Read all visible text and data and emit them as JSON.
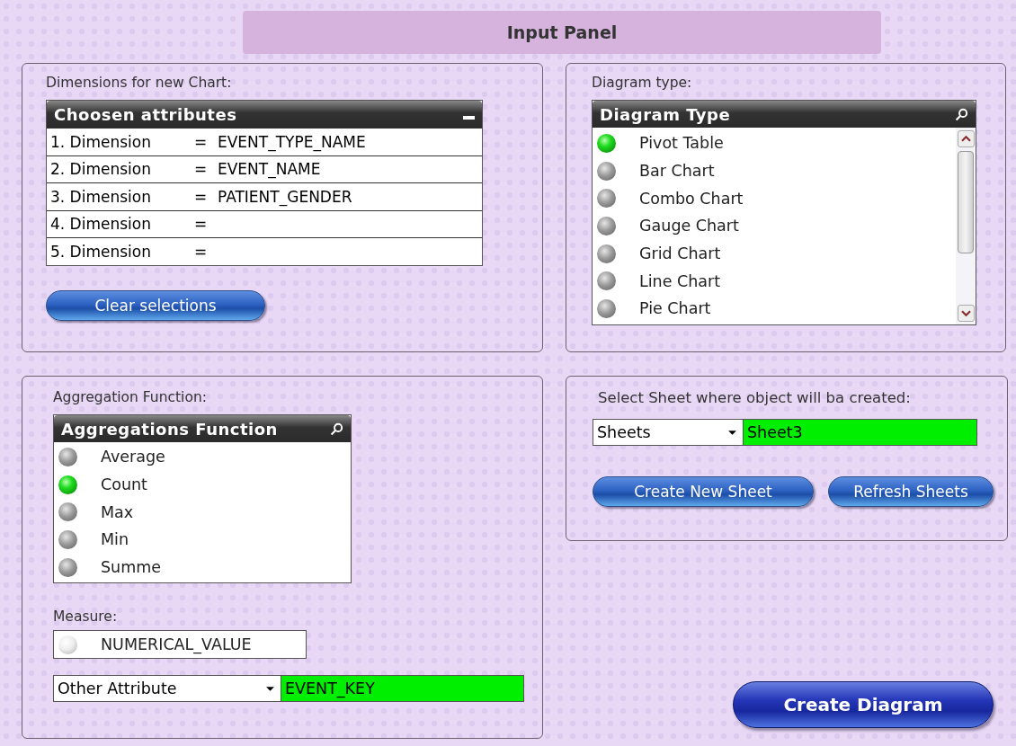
{
  "title": "Input Panel",
  "dimensions": {
    "label": "Dimensions for new Chart:",
    "header": "Choosen attributes",
    "rows": [
      {
        "name": "1. Dimension",
        "equals": "=",
        "value": "EVENT_TYPE_NAME"
      },
      {
        "name": "2. Dimension",
        "equals": "=",
        "value": "EVENT_NAME"
      },
      {
        "name": "3. Dimension",
        "equals": "=",
        "value": "PATIENT_GENDER"
      },
      {
        "name": "4. Dimension",
        "equals": "="
      },
      {
        "name": "5. Dimension",
        "equals": "="
      }
    ],
    "button": "Clear selections"
  },
  "diagram": {
    "label": "Diagram type:",
    "header": "Diagram Type",
    "items": [
      {
        "label": "Pivot Table",
        "selected": true
      },
      {
        "label": "Bar Chart",
        "selected": false,
        "excluded": true
      },
      {
        "label": "Combo Chart",
        "selected": false,
        "excluded": true
      },
      {
        "label": "Gauge Chart",
        "selected": false,
        "excluded": true
      },
      {
        "label": "Grid Chart",
        "selected": false,
        "excluded": true
      },
      {
        "label": "Line Chart",
        "selected": false,
        "excluded": true
      },
      {
        "label": "Pie Chart",
        "selected": false,
        "excluded": true
      }
    ]
  },
  "aggregation": {
    "label": "Aggregation Function:",
    "header": "Aggregations Function",
    "items": [
      {
        "label": "Average",
        "selected": false,
        "excluded": true
      },
      {
        "label": "Count",
        "selected": true
      },
      {
        "label": "Max",
        "selected": false,
        "excluded": true
      },
      {
        "label": "Min",
        "selected": false,
        "excluded": true
      },
      {
        "label": "Summe",
        "selected": false,
        "excluded": true
      }
    ]
  },
  "measure": {
    "label": "Measure:",
    "value": "NUMERICAL_VALUE",
    "selected": false,
    "excluded": false
  },
  "other": {
    "dropdown": "Other Attribute",
    "value": "EVENT_KEY"
  },
  "sheet": {
    "label": "Select Sheet where object will ba created:",
    "dropdown": "Sheets",
    "value": "Sheet3",
    "buttons": [
      "Create New Sheet",
      "Refresh Sheets"
    ]
  },
  "create_button": "Create Diagram"
}
